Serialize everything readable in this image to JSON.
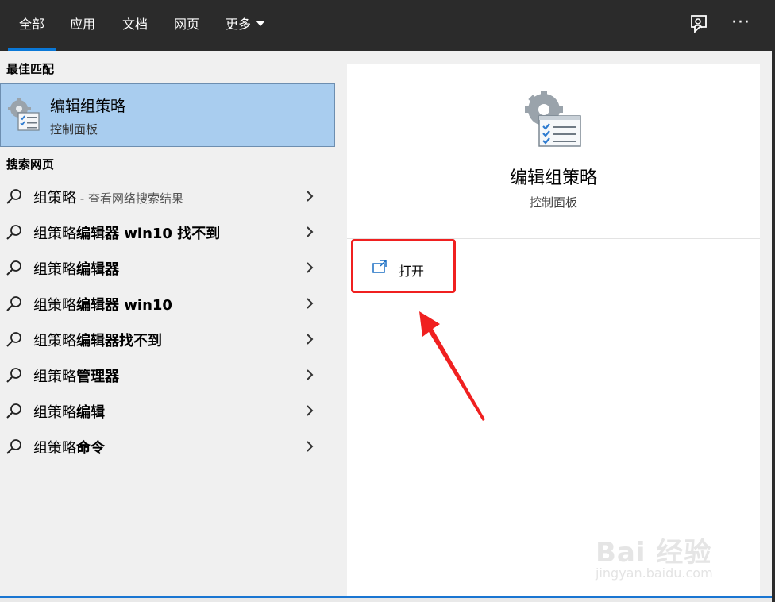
{
  "tabs": [
    {
      "label": "全部",
      "active": true
    },
    {
      "label": "应用"
    },
    {
      "label": "文档"
    },
    {
      "label": "网页"
    },
    {
      "label": "更多"
    }
  ],
  "icons": {
    "feedback": "feedback-icon",
    "more": "more-options-icon",
    "more_glyph": "···"
  },
  "left": {
    "best_match_heading": "最佳匹配",
    "best_match": {
      "title": "编辑组策略",
      "subtitle": "控制面板",
      "icon": "group-policy-icon"
    },
    "web_heading": "搜索网页",
    "results": [
      {
        "prefix": "组策略",
        "bold": "",
        "hint": " - 查看网络搜索结果"
      },
      {
        "prefix": "组策略",
        "bold": "编辑器 win10 找不到",
        "hint": ""
      },
      {
        "prefix": "组策略",
        "bold": "编辑器",
        "hint": ""
      },
      {
        "prefix": "组策略",
        "bold": "编辑器 win10",
        "hint": ""
      },
      {
        "prefix": "组策略",
        "bold": "编辑器找不到",
        "hint": ""
      },
      {
        "prefix": "组策略",
        "bold": "管理器",
        "hint": ""
      },
      {
        "prefix": "组策略",
        "bold": "编辑",
        "hint": ""
      },
      {
        "prefix": "组策略",
        "bold": "命令",
        "hint": ""
      }
    ]
  },
  "preview": {
    "title": "编辑组策略",
    "subtitle": "控制面板",
    "open_label": "打开",
    "open_icon": "open-external-icon"
  },
  "watermark": {
    "main": "Bai 经验",
    "sub": "jingyan.baidu.com"
  },
  "colors": {
    "topbar": "#2b2b2b",
    "accent": "#0a78d7",
    "selected": "#a9cdef",
    "annotation": "#f02020"
  }
}
